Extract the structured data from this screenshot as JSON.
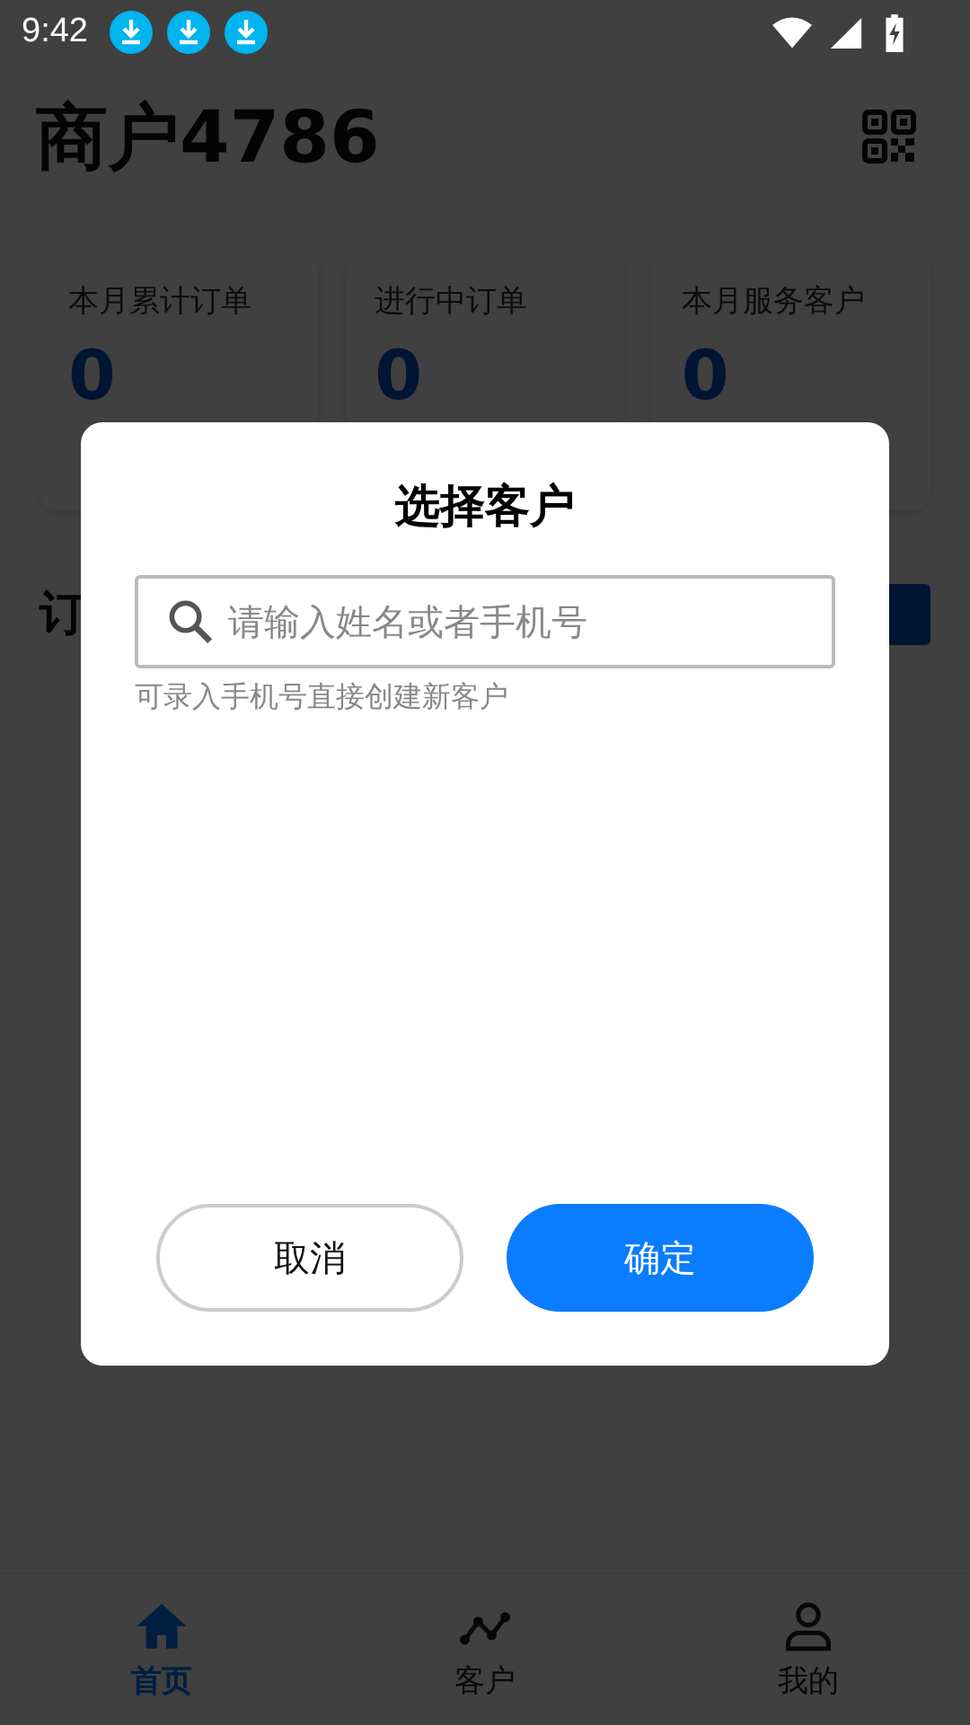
{
  "status_bar": {
    "time": "9:42",
    "notifications": [
      {
        "kind": "download"
      },
      {
        "kind": "download"
      },
      {
        "kind": "download"
      }
    ]
  },
  "header": {
    "title": "商户4786"
  },
  "stats": [
    {
      "label": "本月累计订单",
      "value": "0"
    },
    {
      "label": "进行中订单",
      "value": "0"
    },
    {
      "label": "本月服务客户",
      "value": "0"
    }
  ],
  "section": {
    "title": "订"
  },
  "dialog": {
    "title": "选择客户",
    "search": {
      "placeholder": "请输入姓名或者手机号"
    },
    "hint": "可录入手机号直接创建新客户",
    "buttons": [
      {
        "label": "取消",
        "kind": "secondary"
      },
      {
        "label": "确定",
        "kind": "primary"
      }
    ]
  },
  "bottom_nav": [
    {
      "label": "首页",
      "selected": true
    },
    {
      "label": "客户",
      "selected": false
    },
    {
      "label": "我的",
      "selected": false
    }
  ]
}
